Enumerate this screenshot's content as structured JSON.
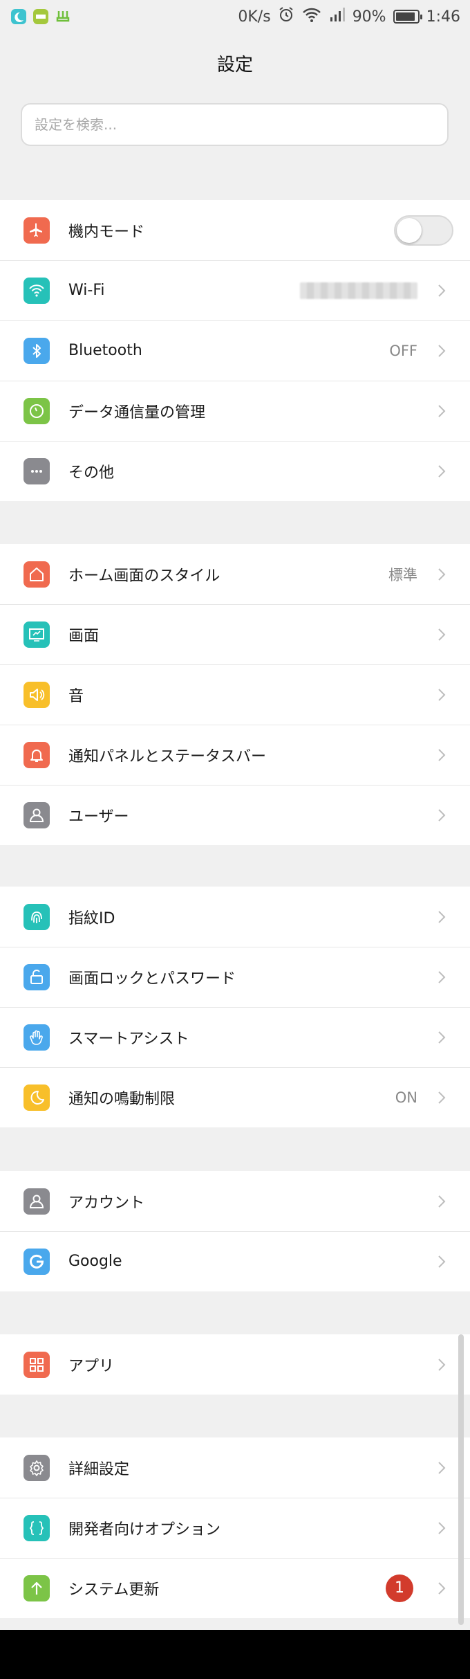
{
  "status_bar": {
    "speed": "0K/s",
    "battery": "90%",
    "battery_level": 0.9,
    "time": "1:46",
    "left_icons": [
      "moon-app-icon",
      "new-app-icon",
      "usb-debug-icon"
    ],
    "right_icons": [
      "alarm-icon",
      "wifi-icon",
      "signal-icon",
      "battery-icon"
    ]
  },
  "header": {
    "title": "設定"
  },
  "search": {
    "placeholder": "設定を検索..."
  },
  "sections": [
    [
      {
        "label": "機内モード",
        "icon": "airplane-icon",
        "color": "#f06a4f",
        "control": "toggle",
        "on": false
      },
      {
        "label": "Wi-Fi",
        "icon": "wifi-icon",
        "color": "#26c1b8",
        "value_obscured": true
      },
      {
        "label": "Bluetooth",
        "icon": "bluetooth-icon",
        "color": "#4aa8ec",
        "value": "OFF"
      },
      {
        "label": "データ通信量の管理",
        "icon": "data-usage-icon",
        "color": "#7cc447"
      },
      {
        "label": "その他",
        "icon": "more-icon",
        "color": "#8a8a8f"
      }
    ],
    [
      {
        "label": "ホーム画面のスタイル",
        "icon": "home-icon",
        "color": "#f06a4f",
        "value": "標準"
      },
      {
        "label": "画面",
        "icon": "display-icon",
        "color": "#26c1b8"
      },
      {
        "label": "音",
        "icon": "speaker-icon",
        "color": "#f8bf2a"
      },
      {
        "label": "通知パネルとステータスバー",
        "icon": "bell-icon",
        "color": "#f06a4f"
      },
      {
        "label": "ユーザー",
        "icon": "user-icon",
        "color": "#8a8a8f"
      }
    ],
    [
      {
        "label": "指紋ID",
        "icon": "fingerprint-icon",
        "color": "#26c1b8"
      },
      {
        "label": "画面ロックとパスワード",
        "icon": "lock-icon",
        "color": "#4aa8ec"
      },
      {
        "label": "スマートアシスト",
        "icon": "hand-icon",
        "color": "#4aa8ec"
      },
      {
        "label": "通知の鳴動制限",
        "icon": "moon-icon",
        "color": "#f8bf2a",
        "value": "ON"
      }
    ],
    [
      {
        "label": "アカウント",
        "icon": "account-icon",
        "color": "#8a8a8f"
      },
      {
        "label": "Google",
        "icon": "google-icon",
        "color": "#4aa8ec"
      }
    ],
    [
      {
        "label": "アプリ",
        "icon": "apps-icon",
        "color": "#f06a4f"
      }
    ],
    [
      {
        "label": "詳細設定",
        "icon": "gear-icon",
        "color": "#8a8a8f"
      },
      {
        "label": "開発者向けオプション",
        "icon": "braces-icon",
        "color": "#26c1b8"
      },
      {
        "label": "システム更新",
        "icon": "arrow-up-icon",
        "color": "#7cc447",
        "badge": "1"
      }
    ]
  ]
}
